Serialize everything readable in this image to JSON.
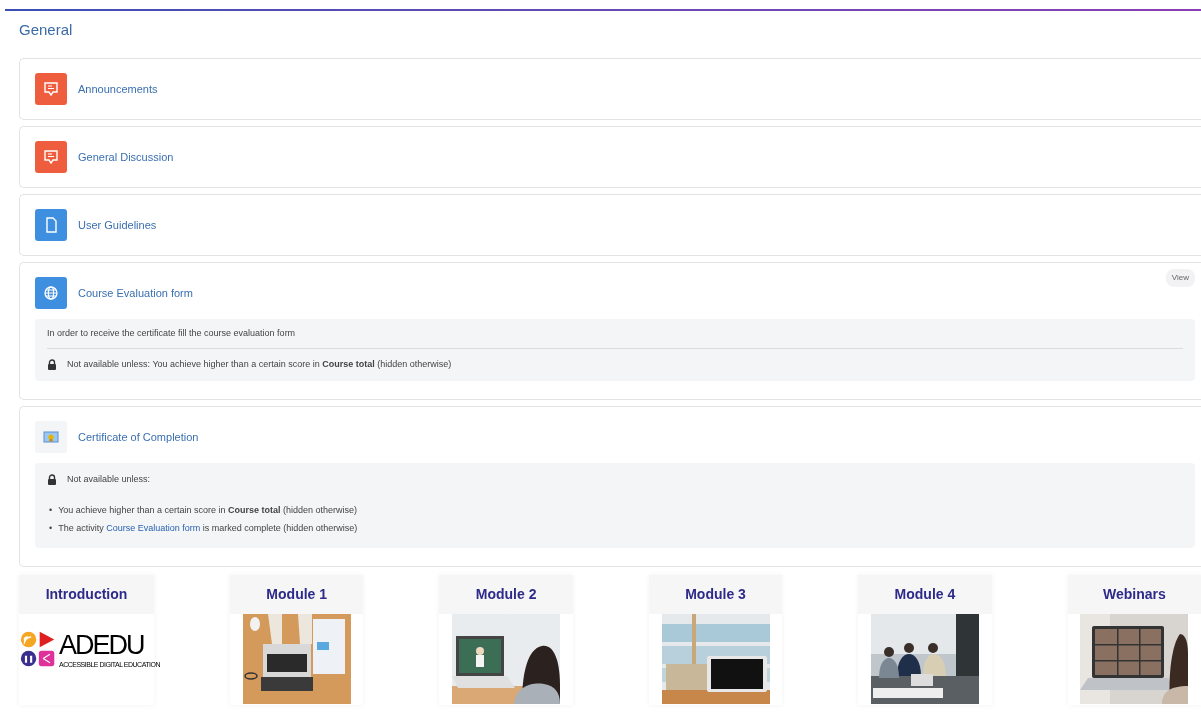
{
  "section": {
    "title": "General"
  },
  "activities": [
    {
      "name": "Announcements",
      "kind": "forum"
    },
    {
      "name": "General Discussion",
      "kind": "forum"
    },
    {
      "name": "User Guidelines",
      "kind": "page"
    },
    {
      "name": "Course Evaluation form",
      "kind": "url",
      "button": "View",
      "description": "In order to receive the certificate fill the course evaluation form",
      "restriction": {
        "lead": "Not available unless: You achieve higher than a certain score in **Course total** (hidden otherwise)"
      }
    },
    {
      "name": "Certificate of Completion",
      "kind": "certificate",
      "restriction": {
        "lead": "Not available unless:",
        "items": [
          {
            "bullet": "•",
            "text": "You achieve higher than a certain score in **Course total** (hidden otherwise)"
          },
          {
            "bullet": "•",
            "before": "The activity ",
            "link": "Course Evaluation form",
            "after": " is marked complete (hidden otherwise)"
          }
        ]
      }
    }
  ],
  "modules": [
    {
      "title": "Introduction",
      "kind": "logo",
      "logo_text": "ADEDU",
      "logo_tagline": "ACCESSIBLE DIGITAL EDUCATION"
    },
    {
      "title": "Module 1",
      "kind": "picture"
    },
    {
      "title": "Module 2",
      "kind": "picture"
    },
    {
      "title": "Module 3",
      "kind": "picture"
    },
    {
      "title": "Module 4",
      "kind": "picture"
    },
    {
      "title": "Webinars",
      "kind": "picture"
    }
  ]
}
